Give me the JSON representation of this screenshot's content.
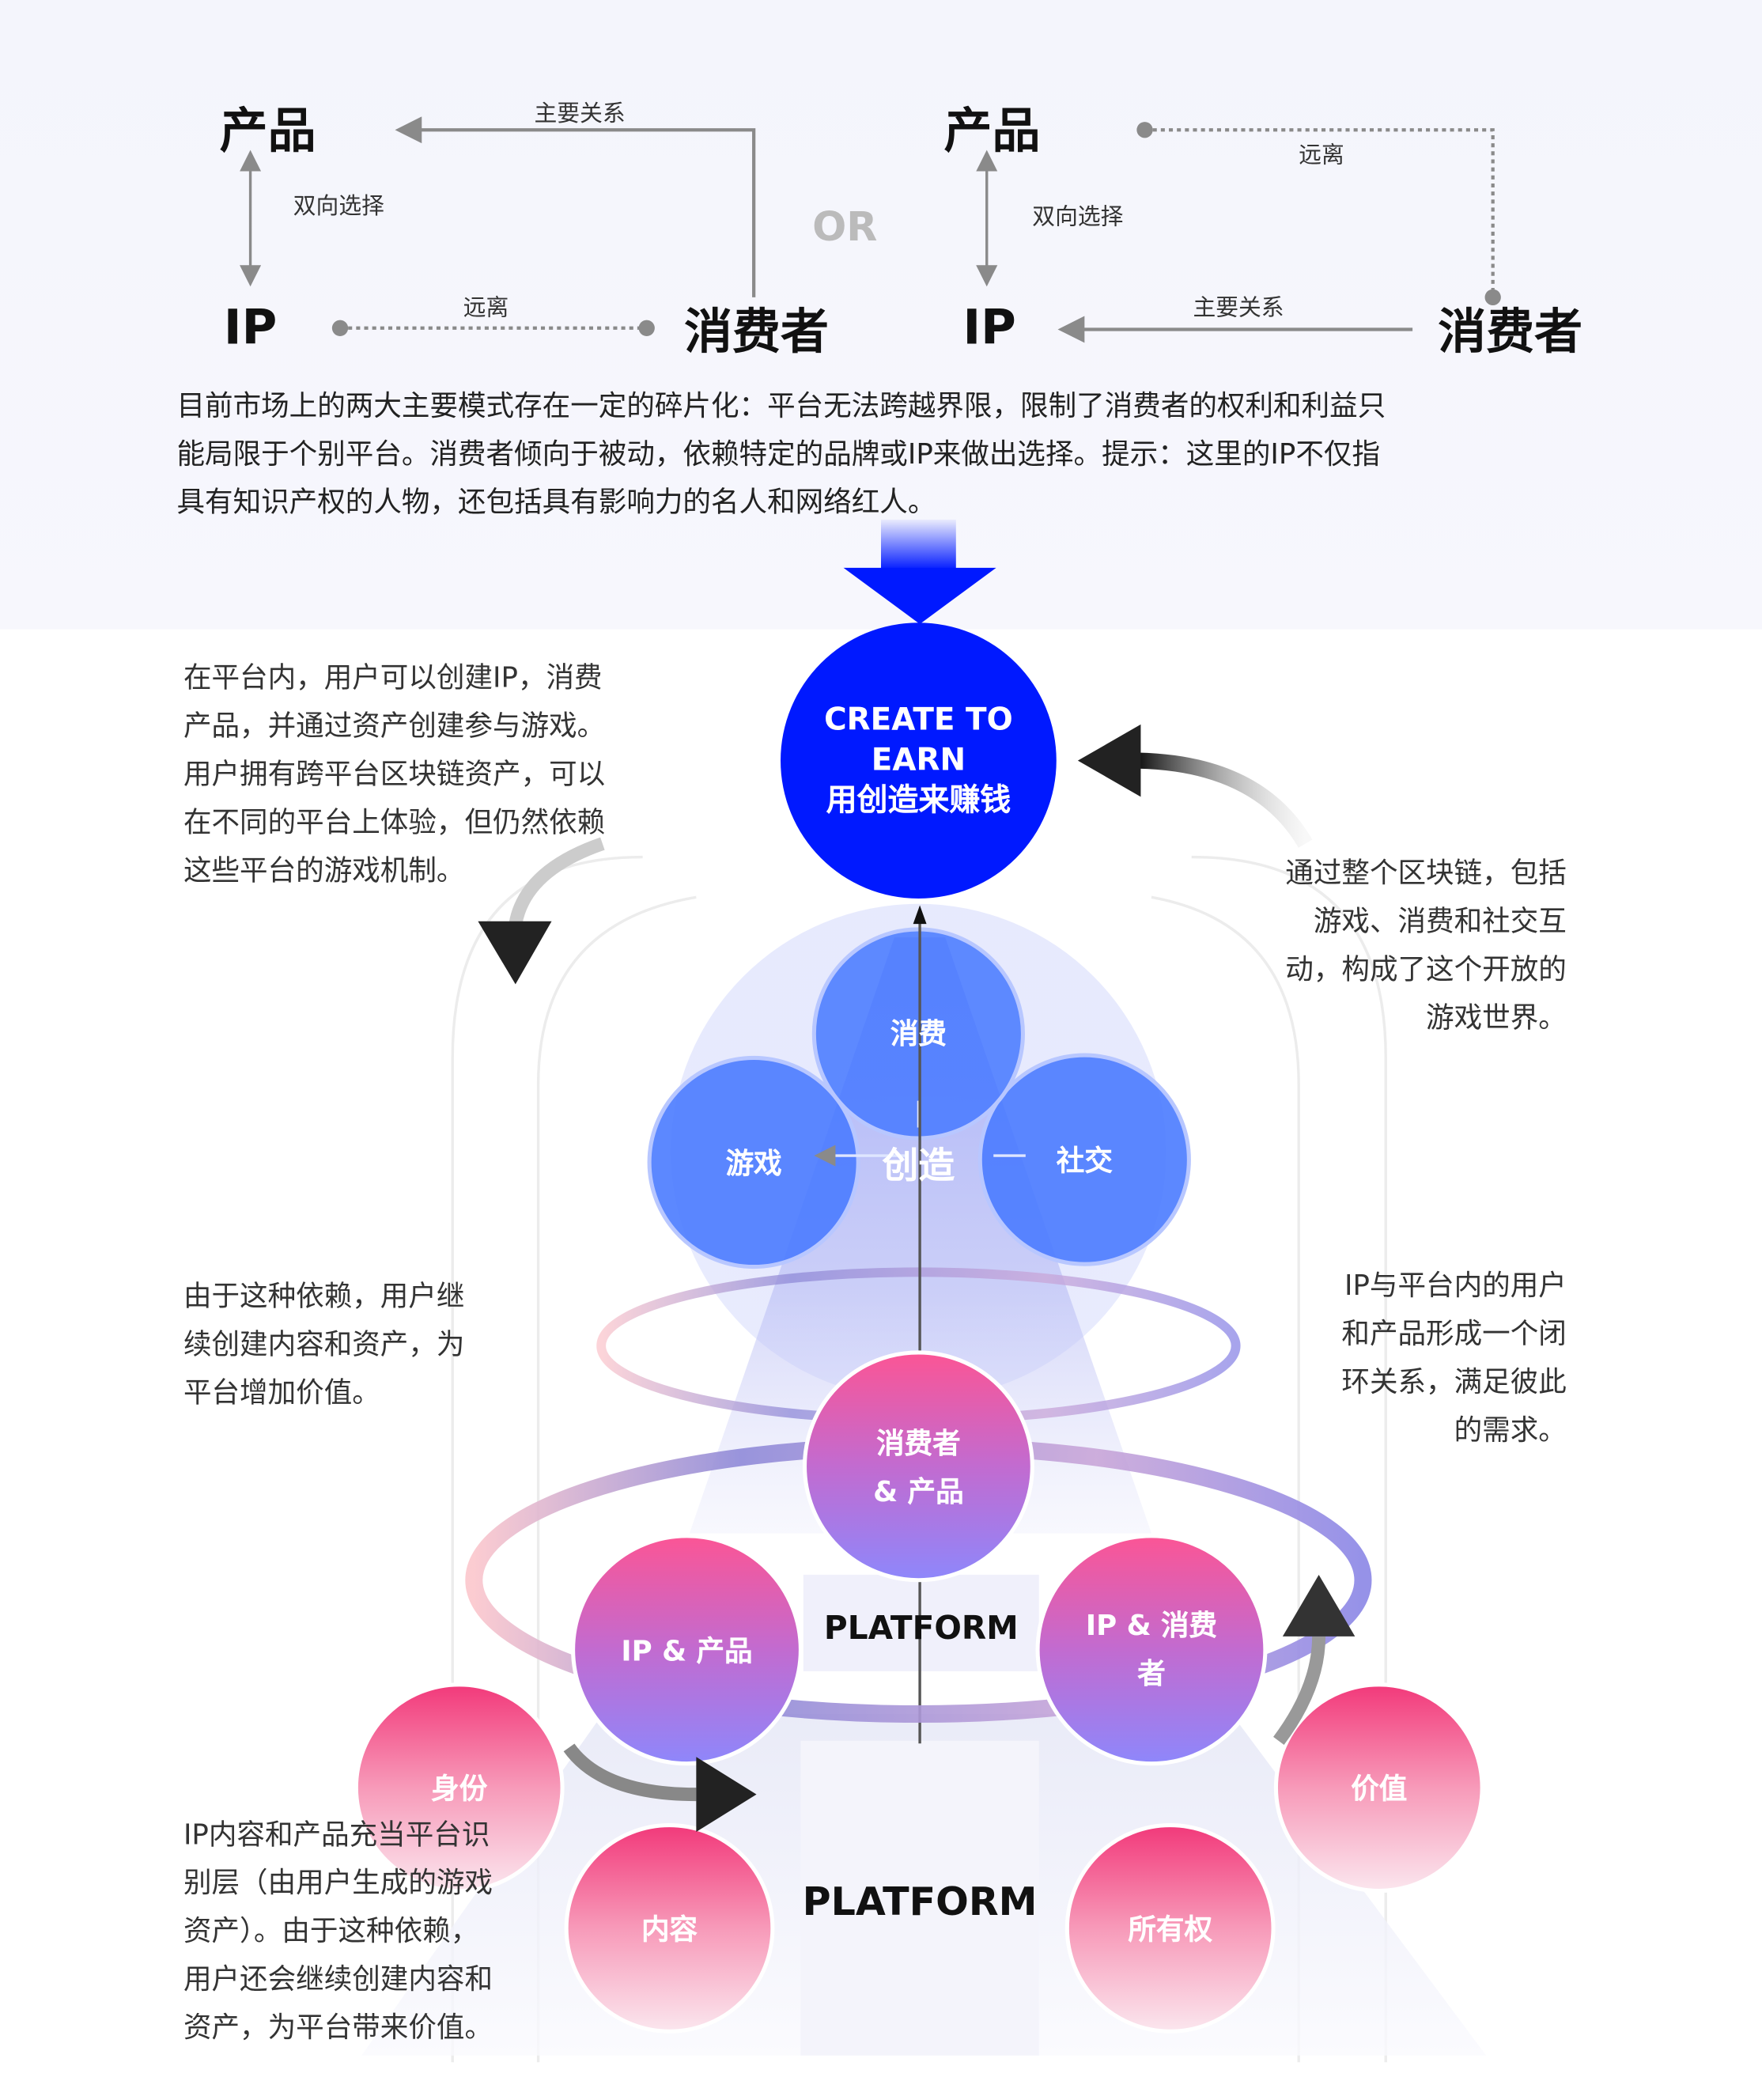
{
  "top": {
    "left": {
      "product": "产品",
      "ip": "IP",
      "consumer": "消费者",
      "main_relation": "主要关系",
      "bidirectional": "双向选择",
      "distant": "远离"
    },
    "or_label": "OR",
    "right": {
      "product": "产品",
      "ip": "IP",
      "consumer": "消费者",
      "main_relation": "主要关系",
      "bidirectional": "双向选择",
      "distant": "远离"
    },
    "description": [
      "目前市场上的两大主要模式存在一定的碎片化：平台无法跨越界限，限制了消费者的权利和利益只",
      "能局限于个别平台。消费者倾向于被动，依赖特定的品牌或IP来做出选择。提示：这里的IP不仅指",
      "具有知识产权的人物，还包括具有影响力的名人和网络红人。"
    ]
  },
  "hub": {
    "line1": "CREATE TO",
    "line2": "EARN",
    "line3": "用创造来赚钱"
  },
  "notes": {
    "top_left": [
      "在平台内，用户可以创建IP，消费",
      "产品，并通过资产创建参与游戏。",
      "用户拥有跨平台区块链资产，可以",
      "在不同的平台上体验，但仍然依赖",
      "这些平台的游戏机制。"
    ],
    "top_right": [
      "通过整个区块链，包括",
      "游戏、消费和社交互",
      "动，构成了这个开放的",
      "游戏世界。"
    ],
    "mid_left": [
      "由于这种依赖，用户继",
      "续创建内容和资产，为",
      "平台增加价值。"
    ],
    "mid_right": [
      "IP与平台内的用户",
      "和产品形成一个闭",
      "环关系，满足彼此",
      "的需求。"
    ],
    "bottom_left": [
      "IP内容和产品充当平台识",
      "别层（由用户生成的游戏",
      "资产）。由于这种依赖，",
      "用户还会继续创建内容和",
      "资产，为平台带来价值。"
    ]
  },
  "sphere": {
    "consume": "消费",
    "game": "游戏",
    "social": "社交",
    "create": "创造"
  },
  "middle": {
    "consumer_product_1": "消费者",
    "consumer_product_2": "& 产品",
    "ip_product": "IP & 产品",
    "ip_consumer_1": "IP & 消费",
    "ip_consumer_2": "者",
    "platform": "PLATFORM"
  },
  "base": {
    "identity": "身份",
    "content": "内容",
    "ownership": "所有权",
    "value": "价值",
    "platform": "PLATFORM"
  },
  "colors": {
    "blue": "#0019ff",
    "sphere_blue": "#4a7bff",
    "pink": "#f23a78",
    "purple": "#8e87fb",
    "gray": "#8a8a8a"
  }
}
